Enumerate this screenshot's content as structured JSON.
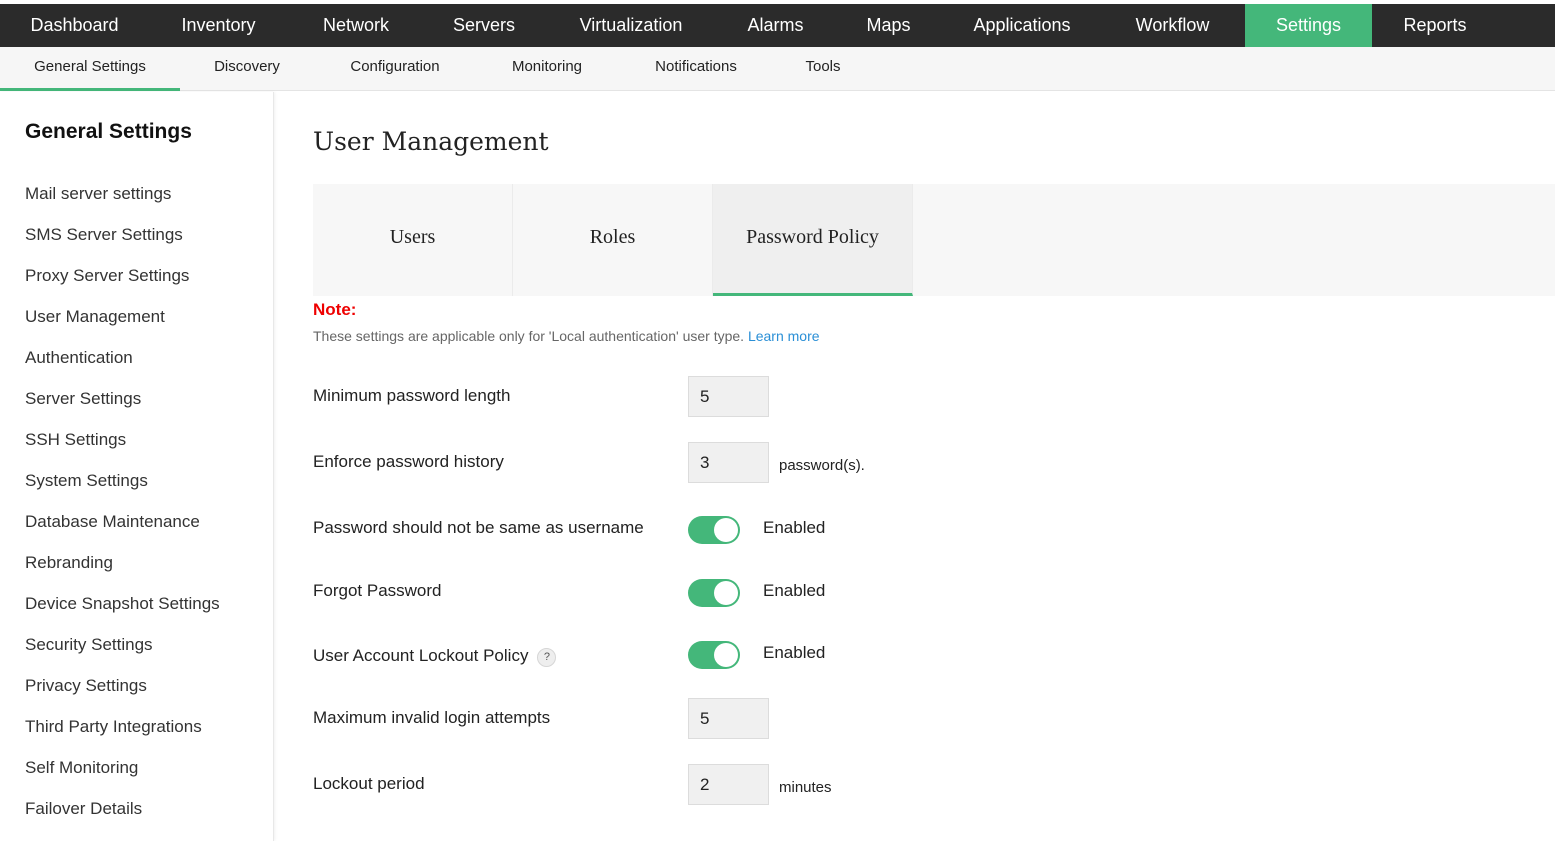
{
  "top_nav": {
    "items": [
      "Dashboard",
      "Inventory",
      "Network",
      "Servers",
      "Virtualization",
      "Alarms",
      "Maps",
      "Applications",
      "Workflow",
      "Settings",
      "Reports"
    ],
    "active": "Settings"
  },
  "sub_nav": {
    "items": [
      "General Settings",
      "Discovery",
      "Configuration",
      "Monitoring",
      "Notifications",
      "Tools"
    ],
    "active": "General Settings"
  },
  "sidebar": {
    "title": "General Settings",
    "items": [
      "Mail server settings",
      "SMS Server Settings",
      "Proxy Server Settings",
      "User Management",
      "Authentication",
      "Server Settings",
      "SSH Settings",
      "System Settings",
      "Database Maintenance",
      "Rebranding",
      "Device Snapshot Settings",
      "Security Settings",
      "Privacy Settings",
      "Third Party Integrations",
      "Self Monitoring",
      "Failover Details"
    ]
  },
  "main": {
    "title": "User Management",
    "tabs": [
      "Users",
      "Roles",
      "Password Policy"
    ],
    "active_tab": "Password Policy",
    "note_label": "Note:",
    "note_text": "These settings are applicable only for 'Local authentication' user type.",
    "note_link": "Learn more",
    "fields": {
      "min_length": {
        "label": "Minimum password length",
        "value": "5"
      },
      "history": {
        "label": "Enforce password history",
        "value": "3",
        "unit": "password(s)."
      },
      "not_username": {
        "label": "Password should not be same as username",
        "status": "Enabled"
      },
      "forgot": {
        "label": "Forgot Password",
        "status": "Enabled"
      },
      "lockout_policy": {
        "label": "User Account Lockout Policy",
        "status": "Enabled",
        "help": "?"
      },
      "max_attempts": {
        "label": "Maximum invalid login attempts",
        "value": "5"
      },
      "lockout_period": {
        "label": "Lockout period",
        "value": "2",
        "unit": "minutes"
      }
    }
  },
  "colors": {
    "accent": "#44b77a",
    "top_nav_bg": "#2b2b2b",
    "note": "#ee0000",
    "link": "#2a8fd6"
  }
}
